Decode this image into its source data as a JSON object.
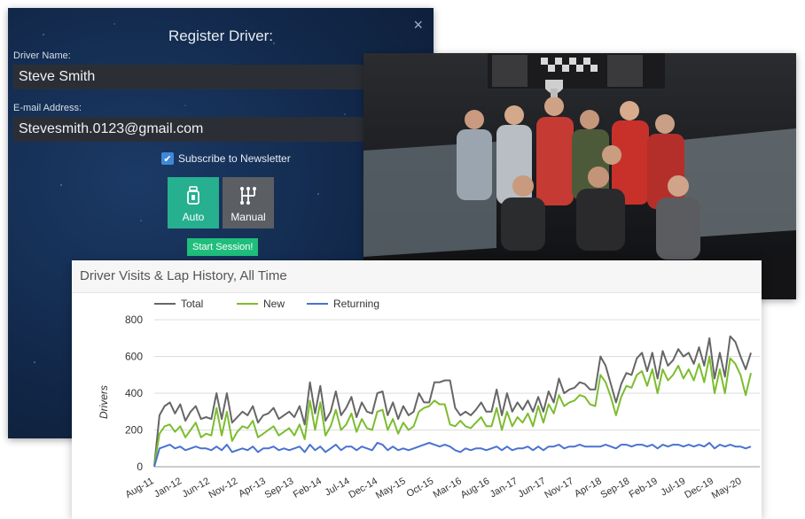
{
  "register": {
    "title": "Register Driver:",
    "close_glyph": "×",
    "driver_name_label": "Driver Name:",
    "driver_name_value": "Steve Smith",
    "email_label": "E-mail Address:",
    "email_value": "Stevesmith.0123@gmail.com",
    "newsletter_label": "Subscribe to Newsletter",
    "newsletter_checked": true,
    "auto_label": "Auto",
    "manual_label": "Manual",
    "start_label": "Start Session!",
    "auto_icon": "automatic-shifter-icon",
    "manual_icon": "manual-gearbox-icon",
    "colors": {
      "auto": "#26b08f",
      "manual": "#5b5e63",
      "start": "#1fbe7c"
    }
  },
  "photo": {
    "description_icon": "group-photo-image"
  },
  "chart": {
    "title": "Driver Visits & Lap History, All Time"
  },
  "chart_data": {
    "type": "line",
    "title": "Driver Visits & Lap History, All Time",
    "xlabel": "",
    "ylabel": "Drivers",
    "ylim": [
      0,
      800
    ],
    "yticks": [
      0,
      200,
      400,
      600,
      800
    ],
    "grid": true,
    "legend_position": "top-left",
    "xtick_labels": [
      "Aug-11",
      "Jan-12",
      "Jun-12",
      "Nov-12",
      "Apr-13",
      "Sep-13",
      "Feb-14",
      "Jul-14",
      "Dec-14",
      "May-15",
      "Oct-15",
      "Mar-16",
      "Aug-16",
      "Jan-17",
      "Jun-17",
      "Nov-17",
      "Apr-18",
      "Sep-18",
      "Feb-19",
      "Jul-19",
      "Dec-19",
      "May-20"
    ],
    "series": [
      {
        "name": "Total",
        "color": "#666666",
        "values": [
          5,
          280,
          330,
          350,
          290,
          340,
          250,
          300,
          330,
          260,
          270,
          260,
          400,
          260,
          400,
          240,
          270,
          300,
          280,
          330,
          240,
          280,
          290,
          320,
          260,
          280,
          300,
          270,
          330,
          230,
          460,
          290,
          440,
          250,
          300,
          410,
          280,
          320,
          380,
          270,
          350,
          300,
          290,
          400,
          410,
          280,
          350,
          260,
          330,
          280,
          300,
          400,
          350,
          350,
          460,
          460,
          470,
          470,
          320,
          280,
          300,
          280,
          310,
          350,
          300,
          300,
          420,
          280,
          400,
          300,
          350,
          310,
          360,
          300,
          380,
          300,
          410,
          350,
          480,
          400,
          420,
          430,
          460,
          450,
          420,
          420,
          600,
          550,
          450,
          350,
          450,
          510,
          500,
          590,
          620,
          520,
          620,
          480,
          630,
          550,
          580,
          640,
          600,
          620,
          560,
          650,
          550,
          700,
          480,
          620,
          490,
          710,
          680,
          600,
          530,
          620
        ],
        "values_note": ""
      },
      {
        "name": "New",
        "color": "#7cbd2f",
        "values": [
          5,
          180,
          220,
          230,
          190,
          220,
          160,
          200,
          240,
          160,
          180,
          170,
          320,
          170,
          300,
          140,
          190,
          220,
          210,
          250,
          160,
          180,
          200,
          220,
          170,
          190,
          210,
          170,
          230,
          150,
          360,
          200,
          350,
          170,
          220,
          310,
          200,
          230,
          290,
          190,
          260,
          210,
          200,
          300,
          310,
          200,
          260,
          180,
          240,
          200,
          220,
          300,
          320,
          330,
          360,
          340,
          340,
          230,
          220,
          250,
          220,
          210,
          240,
          270,
          220,
          220,
          320,
          200,
          300,
          220,
          270,
          240,
          290,
          220,
          330,
          240,
          340,
          290,
          390,
          330,
          350,
          360,
          390,
          380,
          340,
          330,
          500,
          460,
          380,
          280,
          380,
          440,
          430,
          500,
          520,
          440,
          530,
          400,
          530,
          470,
          500,
          550,
          480,
          530,
          470,
          560,
          460,
          600,
          400,
          530,
          400,
          590,
          560,
          500,
          390,
          510
        ]
      },
      {
        "name": "Returning",
        "color": "#4a72d0",
        "values": [
          0,
          100,
          110,
          120,
          100,
          110,
          90,
          100,
          110,
          100,
          100,
          90,
          110,
          90,
          120,
          80,
          90,
          100,
          90,
          110,
          80,
          100,
          100,
          110,
          90,
          100,
          90,
          100,
          110,
          80,
          120,
          90,
          110,
          80,
          100,
          120,
          90,
          110,
          110,
          90,
          110,
          100,
          90,
          130,
          120,
          90,
          110,
          90,
          100,
          90,
          100,
          110,
          120,
          130,
          120,
          110,
          120,
          110,
          90,
          80,
          100,
          90,
          100,
          100,
          90,
          100,
          110,
          90,
          110,
          90,
          100,
          100,
          110,
          90,
          110,
          90,
          110,
          110,
          120,
          100,
          110,
          110,
          120,
          110,
          110,
          110,
          110,
          120,
          110,
          100,
          120,
          120,
          110,
          120,
          120,
          110,
          120,
          100,
          120,
          110,
          120,
          120,
          110,
          120,
          110,
          120,
          110,
          130,
          100,
          120,
          110,
          120,
          110,
          110,
          100,
          110
        ]
      }
    ]
  }
}
